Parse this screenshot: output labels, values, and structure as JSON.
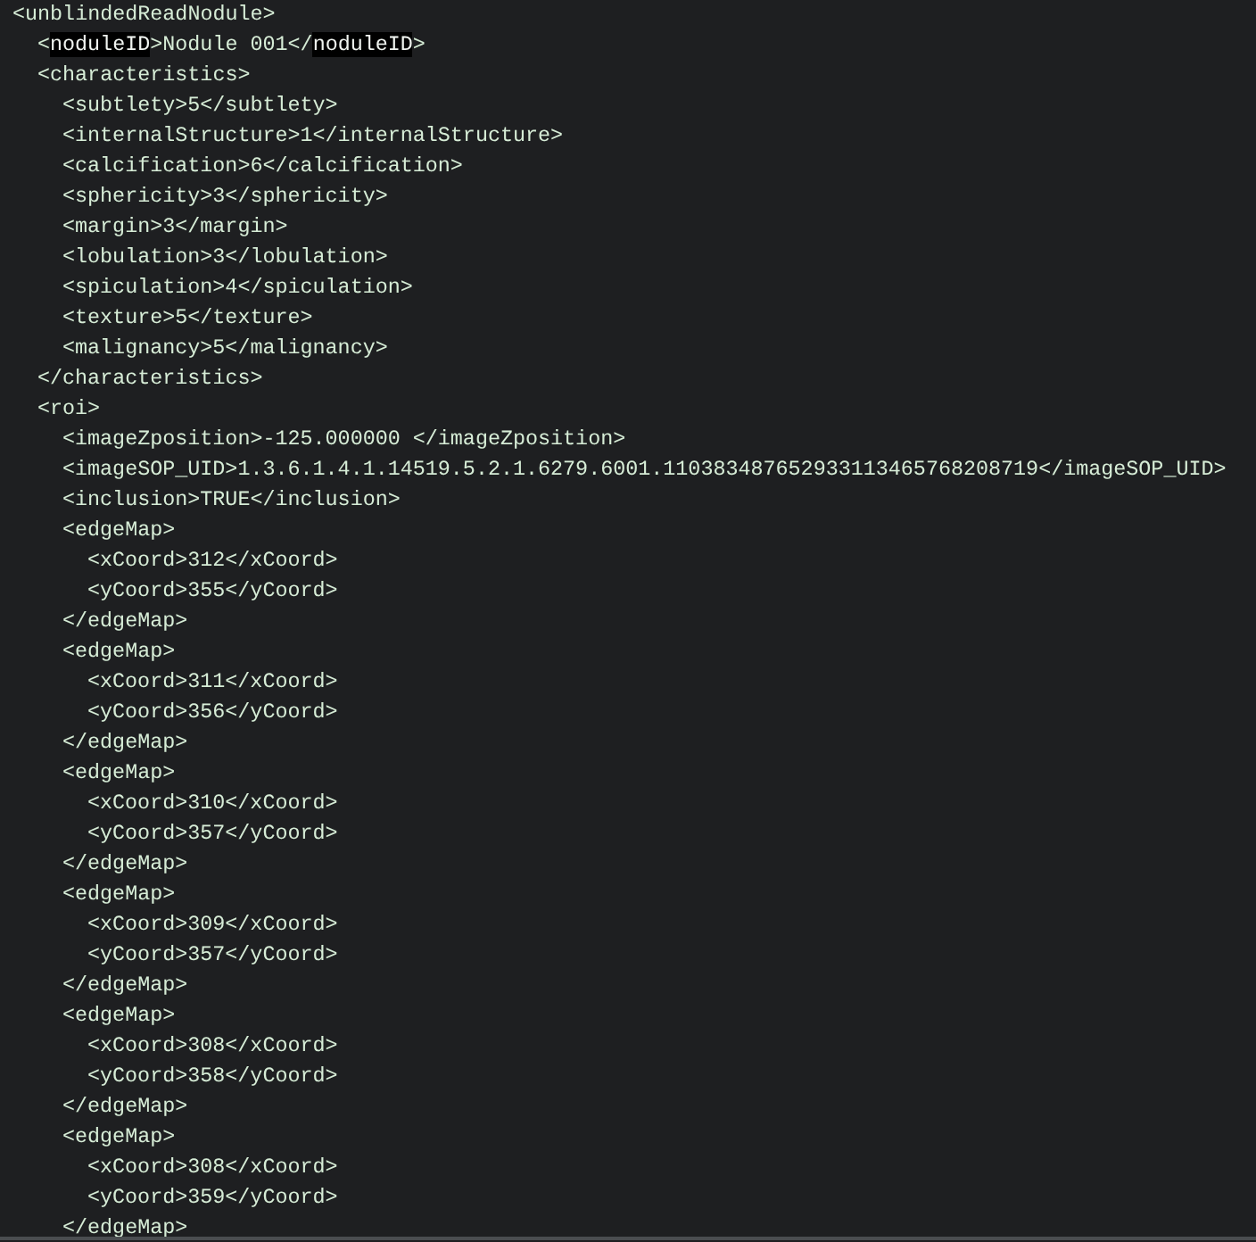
{
  "editor": {
    "lines": [
      {
        "text": "<unblindedReadNodule>",
        "children": [
          {
            "parts": [
              {
                "text": "<",
                "highlighted": false
              },
              {
                "text": "noduleID",
                "highlighted": true
              },
              {
                "text": ">Nodule 001</",
                "highlighted": false
              },
              {
                "text": "noduleID",
                "highlighted": true
              },
              {
                "text": ">",
                "highlighted": false
              }
            ]
          },
          {
            "text": "<characteristics>",
            "close": "</characteristics>",
            "children": [
              {
                "text": "<subtlety>5</subtlety>"
              },
              {
                "text": "<internalStructure>1</internalStructure>"
              },
              {
                "text": "<calcification>6</calcification>"
              },
              {
                "text": "<sphericity>3</sphericity>"
              },
              {
                "text": "<margin>3</margin>"
              },
              {
                "text": "<lobulation>3</lobulation>"
              },
              {
                "text": "<spiculation>4</spiculation>"
              },
              {
                "text": "<texture>5</texture>"
              },
              {
                "text": "<malignancy>5</malignancy>"
              }
            ]
          },
          {
            "text": "<roi>",
            "children": [
              {
                "text": "<imageZposition>-125.000000 </imageZposition>"
              },
              {
                "text": "<imageSOP_UID>1.3.6.1.4.1.14519.5.2.1.6279.6001.110383487652933113465768208719</imageSOP_UID>"
              },
              {
                "text": "<inclusion>TRUE</inclusion>"
              },
              {
                "text": "<edgeMap>",
                "close": "</edgeMap>",
                "children": [
                  {
                    "text": "<xCoord>312</xCoord>"
                  },
                  {
                    "text": "<yCoord>355</yCoord>"
                  }
                ]
              },
              {
                "text": "<edgeMap>",
                "close": "</edgeMap>",
                "children": [
                  {
                    "text": "<xCoord>311</xCoord>"
                  },
                  {
                    "text": "<yCoord>356</yCoord>"
                  }
                ]
              },
              {
                "text": "<edgeMap>",
                "close": "</edgeMap>",
                "children": [
                  {
                    "text": "<xCoord>310</xCoord>"
                  },
                  {
                    "text": "<yCoord>357</yCoord>"
                  }
                ]
              },
              {
                "text": "<edgeMap>",
                "close": "</edgeMap>",
                "children": [
                  {
                    "text": "<xCoord>309</xCoord>"
                  },
                  {
                    "text": "<yCoord>357</yCoord>"
                  }
                ]
              },
              {
                "text": "<edgeMap>",
                "close": "</edgeMap>",
                "children": [
                  {
                    "text": "<xCoord>308</xCoord>"
                  },
                  {
                    "text": "<yCoord>358</yCoord>"
                  }
                ]
              },
              {
                "text": "<edgeMap>",
                "close": "</edgeMap>",
                "children": [
                  {
                    "text": "<xCoord>308</xCoord>"
                  },
                  {
                    "text": "<yCoord>359</yCoord>"
                  }
                ]
              }
            ]
          }
        ]
      }
    ]
  }
}
